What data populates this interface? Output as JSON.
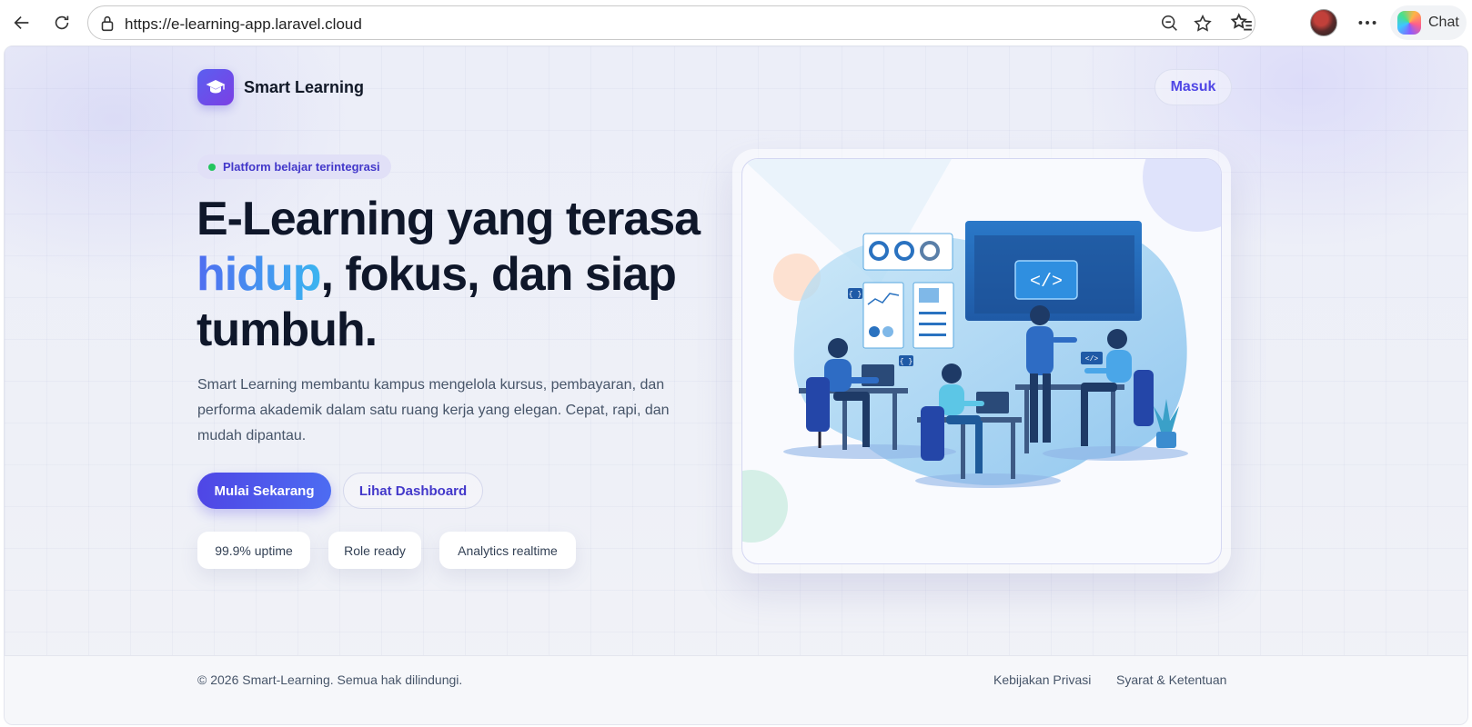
{
  "browser": {
    "url": "https://e-learning-app.laravel.cloud",
    "chat_label": "Chat",
    "icons": [
      "back-arrow-icon",
      "reload-icon",
      "site-info-icon",
      "zoom-out-icon",
      "favorite-star-icon",
      "favorites-list-icon",
      "profile-avatar",
      "more-options-icon",
      "copilot-icon"
    ]
  },
  "header": {
    "brand": "Smart Learning",
    "logo_icon": "graduation-cap-icon",
    "login_label": "Masuk"
  },
  "hero": {
    "badge": "Platform belajar terintegrasi",
    "title_part1": "E-Learning yang terasa",
    "title_accent": "hidup",
    "title_part2": ", fokus, dan siap tumbuh.",
    "description": "Smart Learning membantu kampus mengelola kursus, pembayaran, dan performa akademik dalam satu ruang kerja yang elegan. Cepat, rapi, dan mudah dipantau.",
    "primary_cta": "Mulai Sekarang",
    "secondary_cta": "Lihat Dashboard",
    "stats": [
      "99.9% uptime",
      "Role ready",
      "Analytics realtime"
    ],
    "illustration_code_label": "</>",
    "illustration_brace_label": "{ }"
  },
  "footer": {
    "copyright": "© 2026 Smart-Learning. Semua hak dilindungi.",
    "privacy": "Kebijakan Privasi",
    "terms": "Syarat & Ketentuan"
  },
  "colors": {
    "accent": "#4f46e5",
    "accent_gradient_end": "#3bb5f0",
    "heading": "#0f172a",
    "badge_dot": "#22c55e"
  }
}
